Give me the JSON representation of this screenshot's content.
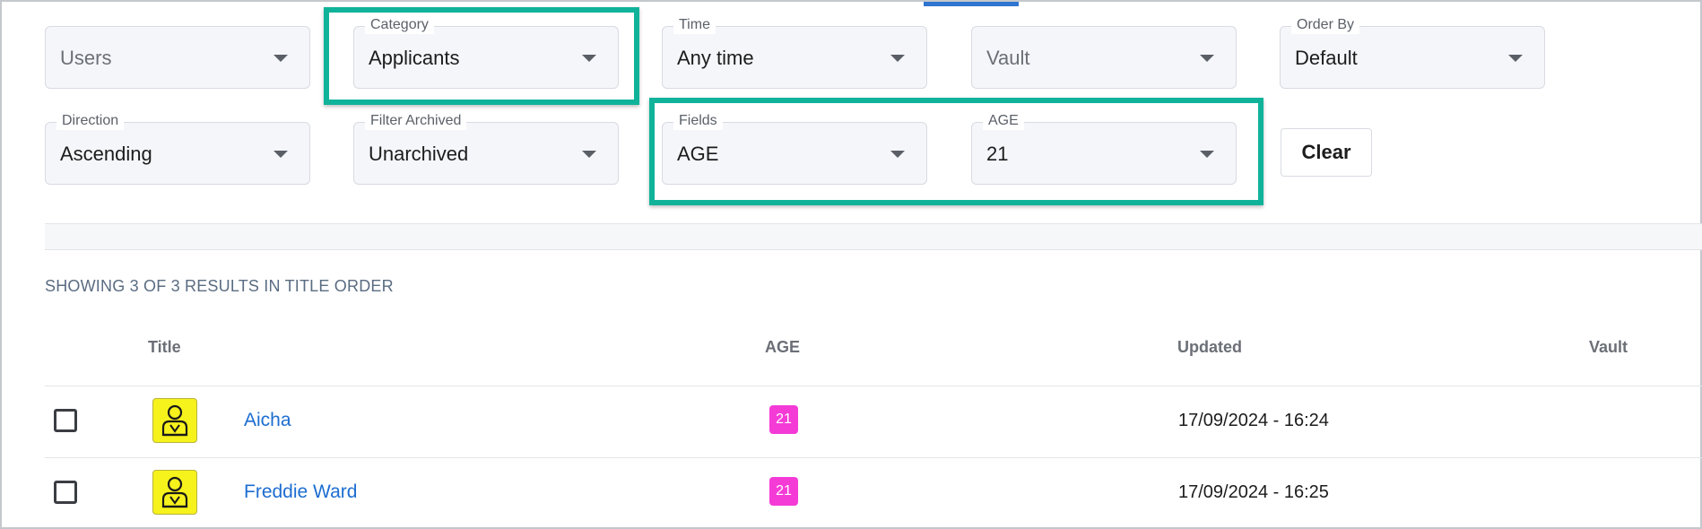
{
  "filters": {
    "row1": [
      {
        "label": "",
        "value": "Users",
        "placeholder": true
      },
      {
        "label": "Category",
        "value": "Applicants",
        "placeholder": false
      },
      {
        "label": "Time",
        "value": "Any time",
        "placeholder": false
      },
      {
        "label": "",
        "value": "Vault",
        "placeholder": true
      },
      {
        "label": "Order By",
        "value": "Default",
        "placeholder": false
      }
    ],
    "row2": [
      {
        "label": "Direction",
        "value": "Ascending"
      },
      {
        "label": "Filter Archived",
        "value": "Unarchived"
      },
      {
        "label": "Fields",
        "value": "AGE"
      },
      {
        "label": "AGE",
        "value": "21"
      }
    ],
    "clear_label": "Clear"
  },
  "results": {
    "summary": "SHOWING 3 OF 3 RESULTS IN TITLE ORDER",
    "columns": [
      "Title",
      "AGE",
      "Updated",
      "Vault"
    ],
    "rows": [
      {
        "title": "Aicha",
        "age": "21",
        "updated": "17/09/2024 - 16:24",
        "vault": ""
      },
      {
        "title": "Freddie Ward",
        "age": "21",
        "updated": "17/09/2024 - 16:25",
        "vault": ""
      }
    ]
  },
  "colors": {
    "highlight": "#10b39a",
    "link": "#1c6dd0",
    "age_badge": "#f43bd6",
    "avatar": "#f6f21c"
  },
  "icons": {
    "dropdown": "caret-down-icon",
    "avatar": "person-icon"
  }
}
